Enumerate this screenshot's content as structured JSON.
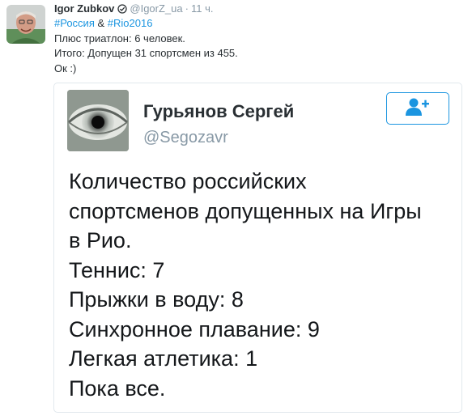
{
  "tweet": {
    "author_name": "Igor Zubkov",
    "author_handle": "@IgorZ_ua",
    "separator": "·",
    "timestamp": "11 ч.",
    "hashtags": {
      "first": "#Россия",
      "joiner": " & ",
      "second": "#Rio2016"
    },
    "lines": [
      "Плюс триатлон: 6 человек.",
      "Итого: Допущен 31 спортсмен из 455.",
      "Ок :)"
    ],
    "icons": {
      "avatar": "user-avatar",
      "verified": "badge-icon"
    }
  },
  "card": {
    "name": "Гурьянов Сергей",
    "handle": "@Segozavr",
    "follow_icon": "add-user-icon",
    "avatar_icon": "eye-avatar",
    "body_lines": [
      "Количество российских",
      "спортсменов допущенных на Игры",
      "в Рио.",
      "Теннис: 7",
      "Прыжки в воду: 8",
      "Синхронное плавание: 9",
      "Легкая атлетика: 1",
      "Пока все."
    ]
  },
  "colors": {
    "link": "#1b95e0",
    "muted": "#8899a6",
    "text": "#292f33",
    "card_border": "#e1e8ed"
  }
}
